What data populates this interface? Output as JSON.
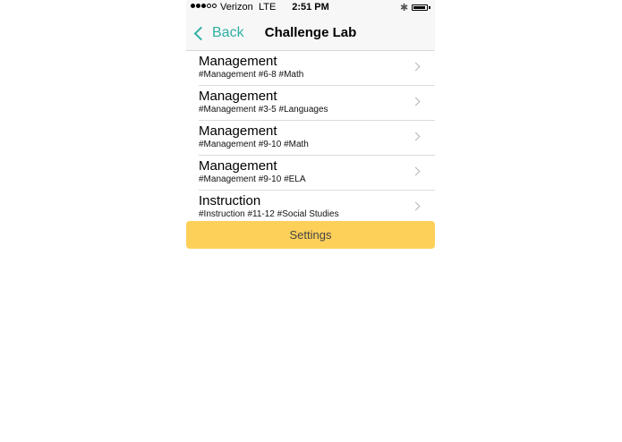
{
  "status_bar": {
    "carrier": "Verizon",
    "network": "LTE",
    "time": "2:51 PM",
    "signal_bars_filled": 3,
    "signal_bars_total": 5,
    "bluetooth_icon": "bluetooth-icon",
    "battery_level": 0.9
  },
  "nav": {
    "back_label": "Back",
    "title": "Challenge Lab"
  },
  "list": {
    "items": [
      {
        "title": "Management",
        "subtitle": "#Management #6-8 #Math"
      },
      {
        "title": "Management",
        "subtitle": "#Management #3-5 #Languages"
      },
      {
        "title": "Management",
        "subtitle": "#Management #9-10 #Math"
      },
      {
        "title": "Management",
        "subtitle": "#Management #9-10 #ELA"
      },
      {
        "title": "Instruction",
        "subtitle": "#Instruction #11-12 #Social Studies"
      }
    ]
  },
  "settings_button": {
    "label": "Settings"
  },
  "colors": {
    "accent": "#2fb0a3",
    "settings_bg": "#fdd05a"
  }
}
